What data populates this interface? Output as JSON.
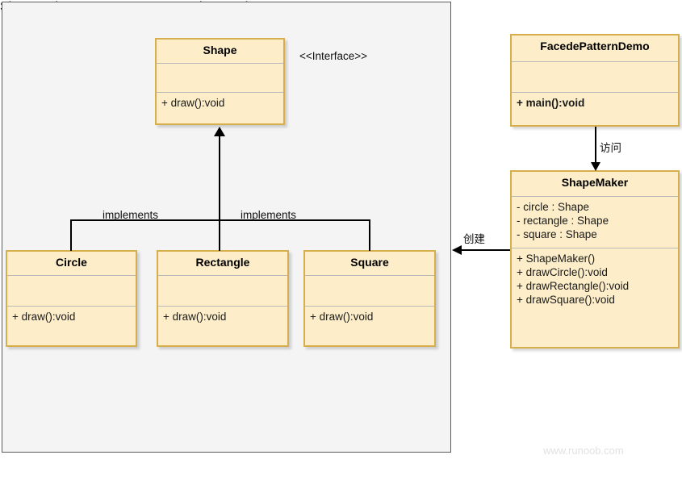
{
  "diagram": {
    "watermark": "www.runoob.com",
    "stereotype": "<<Interface>>",
    "colors": {
      "class_fill": "#fdeec9",
      "class_border": "#d6ae4c",
      "package_fill": "#f4f4f4",
      "package_border": "#5b5b5b",
      "connector": "#000000",
      "watermark": "#e2e2e2"
    }
  },
  "classes": {
    "shape": {
      "name": "Shape",
      "attributes": [],
      "operations": [
        "+ draw():void"
      ]
    },
    "circle": {
      "name": "Circle",
      "attributes": [],
      "operations": [
        "+ draw():void"
      ]
    },
    "rectangle": {
      "name": "Rectangle",
      "attributes": [],
      "operations": [
        "+ draw():void"
      ]
    },
    "square": {
      "name": "Square",
      "attributes": [],
      "operations": [
        "+ draw():void"
      ]
    },
    "demo": {
      "name": "FacedePatternDemo",
      "attributes": [],
      "operations": [
        "+ main():void"
      ]
    },
    "shapemaker": {
      "name": "ShapeMaker",
      "attributes": [
        "- circle : Shape",
        "- rectangle : Shape",
        "- square : Shape"
      ],
      "operations": [
        "+ ShapeMaker()",
        "+ drawCircle():void",
        "+ drawRectangle():void",
        "+ drawSquare():void"
      ]
    }
  },
  "relations": {
    "implements_left": "implements",
    "implements_right": "implements",
    "visit": "访问",
    "create": "创建"
  }
}
